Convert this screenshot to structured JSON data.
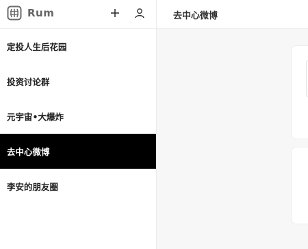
{
  "app": {
    "name": "Rum",
    "icons": {
      "logo": "rum-barrel-logo",
      "add": "plus-icon",
      "user": "user-icon"
    }
  },
  "sidebar": {
    "groups": [
      {
        "label": "定投人生后花园",
        "active": false
      },
      {
        "label": "投资讨论群",
        "active": false
      },
      {
        "label": "元宇宙•大爆炸",
        "active": false
      },
      {
        "label": "去中心微博",
        "active": true
      },
      {
        "label": "李安的朋友圈",
        "active": false
      }
    ]
  },
  "main": {
    "title": "去中心微博"
  },
  "colors": {
    "active_bg": "#000000",
    "active_text": "#ffffff",
    "content_bg": "#f7f7f7",
    "brand_text": "#666666"
  }
}
